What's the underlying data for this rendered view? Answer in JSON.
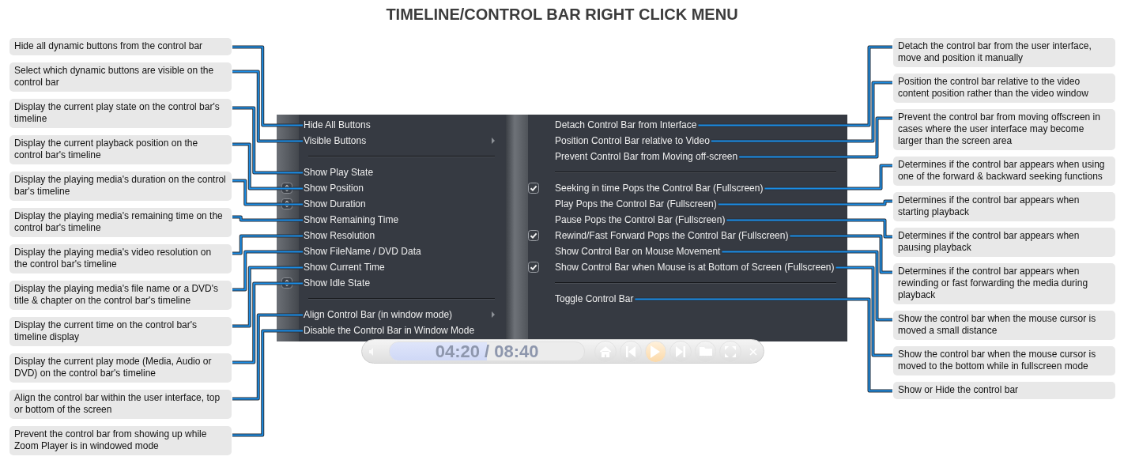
{
  "title": "TIMELINE/CONTROL BAR RIGHT CLICK MENU",
  "left_callouts": [
    "Hide all dynamic buttons from the control bar",
    "Select which dynamic buttons are visible on the control bar",
    "Display the current play state on the control bar's timeline",
    "Display the current playback position on the control bar's timeline",
    "Display the playing media's duration on the control bar's timeline",
    "Display the playing media's remaining time on the control bar's timeline",
    "Display the playing media's video resolution on the control bar's timeline",
    "Display the playing media's file name or a DVD's title & chapter on the control bar's timeline",
    "Display the current time on the control bar's timeline display",
    "Display the current play mode (Media, Audio or DVD) on the control bar's timeline",
    "Align the control bar within the user interface, top or bottom of the screen",
    "Prevent the control bar from showing up while Zoom Player is in windowed mode"
  ],
  "menu": {
    "left_pane": [
      {
        "kind": "item",
        "label": "Hide All Buttons",
        "checked": false,
        "mixed": false
      },
      {
        "kind": "submenu",
        "label": "Visible Buttons",
        "checked": false,
        "mixed": false
      },
      {
        "kind": "separator"
      },
      {
        "kind": "item",
        "label": "Show Play State",
        "checked": false,
        "mixed": false
      },
      {
        "kind": "item",
        "label": "Show Position",
        "checked": false,
        "mixed": true
      },
      {
        "kind": "item",
        "label": "Show Duration",
        "checked": false,
        "mixed": true
      },
      {
        "kind": "item",
        "label": "Show Remaining Time",
        "checked": false,
        "mixed": false
      },
      {
        "kind": "item",
        "label": "Show Resolution",
        "checked": false,
        "mixed": false
      },
      {
        "kind": "item",
        "label": "Show FileName / DVD Data",
        "checked": false,
        "mixed": false
      },
      {
        "kind": "item",
        "label": "Show Current Time",
        "checked": false,
        "mixed": false
      },
      {
        "kind": "item",
        "label": "Show Idle State",
        "checked": false,
        "mixed": true
      },
      {
        "kind": "separator"
      },
      {
        "kind": "submenu",
        "label": "Align Control Bar (in window mode)",
        "checked": false,
        "mixed": false
      },
      {
        "kind": "item",
        "label": "Disable the Control Bar in Window Mode",
        "checked": false,
        "mixed": false
      }
    ],
    "right_pane": [
      {
        "kind": "item",
        "label": "Detach Control Bar from Interface",
        "checked": false,
        "mixed": false
      },
      {
        "kind": "item",
        "label": "Position Control Bar relative to Video",
        "checked": false,
        "mixed": false
      },
      {
        "kind": "item",
        "label": "Prevent Control Bar from Moving off-screen",
        "checked": false,
        "mixed": false
      },
      {
        "kind": "separator"
      },
      {
        "kind": "item",
        "label": "Seeking in time Pops the Control Bar (Fullscreen)",
        "checked": true,
        "mixed": false
      },
      {
        "kind": "item",
        "label": "Play Pops the Control Bar (Fullscreen)",
        "checked": false,
        "mixed": false
      },
      {
        "kind": "item",
        "label": "Pause Pops the Control Bar (Fullscreen)",
        "checked": false,
        "mixed": false
      },
      {
        "kind": "item",
        "label": "Rewind/Fast Forward Pops the Control Bar (Fullscreen)",
        "checked": true,
        "mixed": false
      },
      {
        "kind": "item",
        "label": "Show Control Bar on Mouse Movement",
        "checked": false,
        "mixed": false
      },
      {
        "kind": "item",
        "label": "Show Control Bar when Mouse is at Bottom of Screen (Fullscreen)",
        "checked": true,
        "mixed": false
      },
      {
        "kind": "separator"
      },
      {
        "kind": "item",
        "label": "Toggle Control Bar",
        "checked": false,
        "mixed": false
      }
    ]
  },
  "control_bar": {
    "time": "04:20 / 08:40",
    "level": 0.5
  },
  "right_callouts": [
    "Detach the control bar from the user interface, move and position it manually",
    "Position the control bar relative to the video content position rather than the video window",
    "Prevent the control bar from moving offscreen in cases where the user interface may become larger than the screen area",
    "Determines if the control bar appears when using one of the forward & backward seeking functions",
    "Determines if the control bar appears when starting playback",
    "Determines if the control bar appears when pausing playback",
    "Determines if the control bar appears when rewinding or fast forwarding the media during playback",
    "Show the control bar when the mouse cursor is moved a small distance",
    "Show the control bar when the mouse cursor is moved to the bottom while in fullscreen mode",
    "Show or Hide the control bar"
  ]
}
